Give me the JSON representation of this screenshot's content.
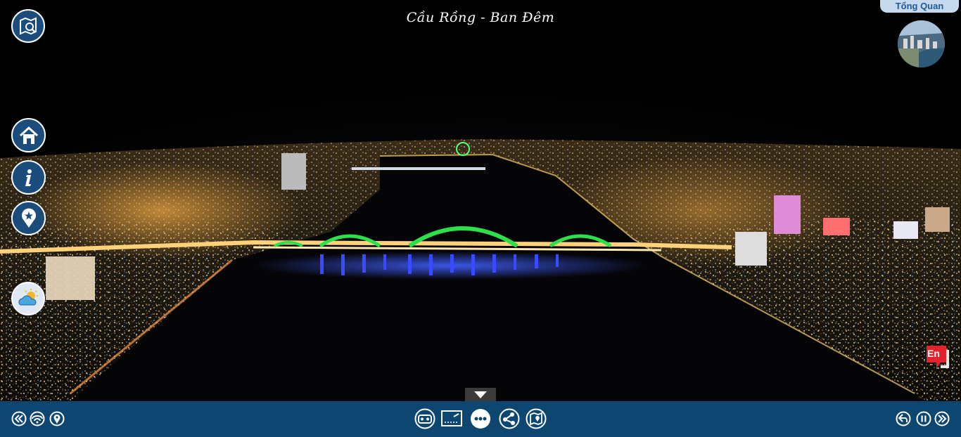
{
  "scene": {
    "title": "Cầu Rồng - Ban Đêm"
  },
  "top_right": {
    "overview_label": "Tổng Quan"
  },
  "language": {
    "badge": "En"
  },
  "left_menu": [
    {
      "id": "map",
      "icon": "map-search-icon"
    },
    {
      "id": "home",
      "icon": "home-icon"
    },
    {
      "id": "info",
      "icon": "info-icon"
    },
    {
      "id": "location",
      "icon": "location-star-icon"
    },
    {
      "id": "weather",
      "icon": "weather-icon"
    }
  ],
  "bottom_left": [
    "rewind-icon",
    "gyro-icon",
    "location-pin-icon"
  ],
  "bottom_center": [
    "vr-icon",
    "dashboard-icon",
    "more-icon",
    "share-icon",
    "map-icon"
  ],
  "bottom_right": [
    "back-icon",
    "pause-icon",
    "forward-icon"
  ],
  "colors": {
    "bar": "#0d4670",
    "button": "#1a4c7c",
    "bridge_glow": "#2be04a",
    "bridge_lights": "#2a3bff",
    "tab": "#c6d9ee",
    "tab_text": "#1d5b96",
    "badge": "#e3232b"
  }
}
